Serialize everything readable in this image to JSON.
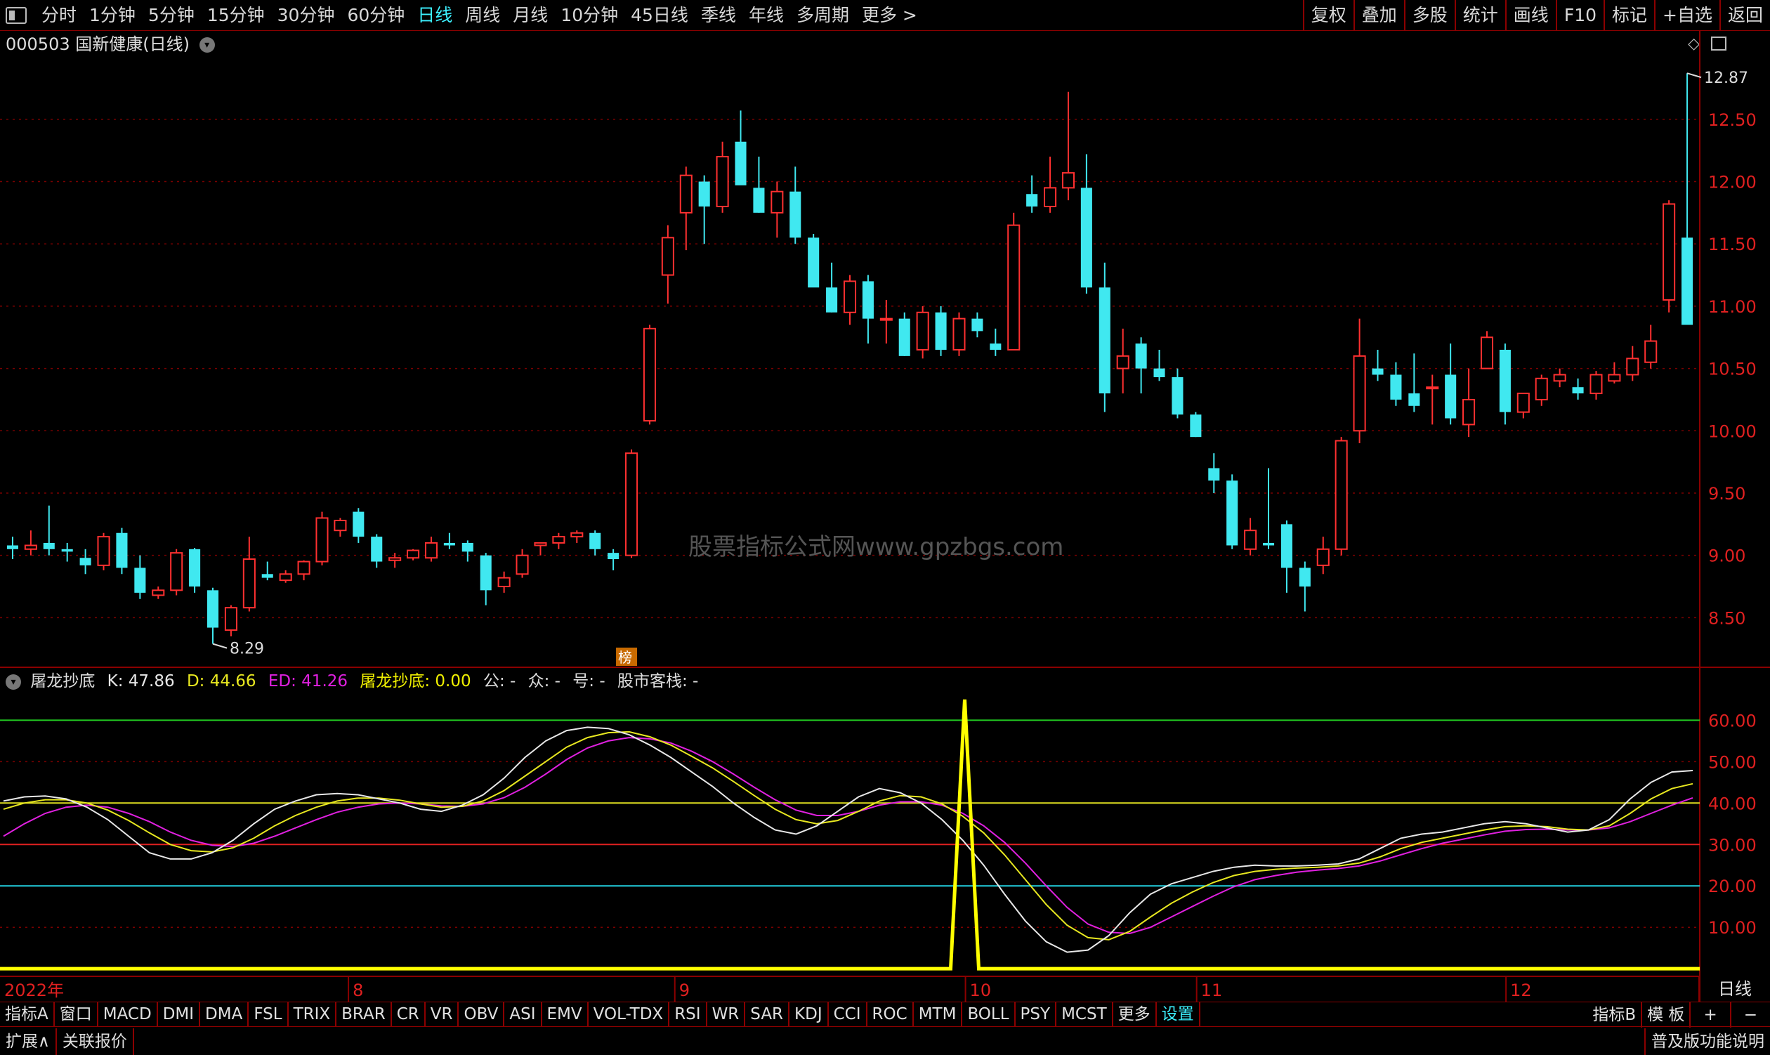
{
  "toolbar": {
    "periods": [
      "分时",
      "1分钟",
      "5分钟",
      "15分钟",
      "30分钟",
      "60分钟",
      "日线",
      "周线",
      "月线",
      "10分钟",
      "45日线",
      "季线",
      "年线",
      "多周期",
      "更多 >"
    ],
    "active_period": "日线",
    "right_buttons": [
      "复权",
      "叠加",
      "多股",
      "统计",
      "画线",
      "F10",
      "标记",
      "+自选",
      "返回"
    ]
  },
  "stock": {
    "code": "000503",
    "name": "国新健康",
    "period_label": "(日线)",
    "title": "000503 国新健康(日线)"
  },
  "price_axis": {
    "labels": [
      "12.50",
      "12.00",
      "11.50",
      "11.00",
      "10.50",
      "10.00",
      "9.50",
      "9.00",
      "8.50"
    ],
    "values": [
      12.5,
      12.0,
      11.5,
      11.0,
      10.5,
      10.0,
      9.5,
      9.0,
      8.5
    ],
    "ylim": [
      8.13,
      12.95
    ]
  },
  "annotations": {
    "high": "12.87",
    "low": "8.29",
    "rank_badge": "榜",
    "watermark": "股票指标公式网www.gpzbgs.com"
  },
  "indicator": {
    "name": "屠龙抄底",
    "k_label": "K: 47.86",
    "d_label": "D: 44.66",
    "ed_label": "ED: 41.26",
    "signal_label": "屠龙抄底: 0.00",
    "extra": [
      "公: -",
      "众: -",
      "号: -",
      "股市客栈: -"
    ],
    "axis_labels": [
      "60.00",
      "50.00",
      "40.00",
      "30.00",
      "20.00",
      "10.00"
    ],
    "axis_values": [
      60,
      50,
      40,
      30,
      20,
      10
    ],
    "ylim": [
      -1.5,
      66
    ],
    "level_lines": [
      {
        "v": 60,
        "color": "#22cc22"
      },
      {
        "v": 40,
        "color": "#e0e020"
      },
      {
        "v": 30,
        "color": "#e02020"
      },
      {
        "v": 20,
        "color": "#22d0e0"
      }
    ]
  },
  "date_axis": {
    "labels": [
      "2022年",
      "8",
      "9",
      "10",
      "11",
      "12"
    ],
    "positions": [
      0,
      20.5,
      39.7,
      56.8,
      70.4,
      88.6
    ]
  },
  "chart_data": {
    "type": "candlestick",
    "n": 93,
    "ylim": [
      8.13,
      12.95
    ],
    "ohlc": [
      [
        9.08,
        9.15,
        8.97,
        9.05
      ],
      [
        9.05,
        9.2,
        9.0,
        9.08
      ],
      [
        9.1,
        9.4,
        9.0,
        9.05
      ],
      [
        9.05,
        9.1,
        8.95,
        9.03
      ],
      [
        8.98,
        9.05,
        8.85,
        8.92
      ],
      [
        8.92,
        9.18,
        8.88,
        9.15
      ],
      [
        9.18,
        9.22,
        8.85,
        8.9
      ],
      [
        8.9,
        9.0,
        8.65,
        8.7
      ],
      [
        8.68,
        8.75,
        8.65,
        8.72
      ],
      [
        8.72,
        9.05,
        8.68,
        9.02
      ],
      [
        9.05,
        9.06,
        8.7,
        8.75
      ],
      [
        8.72,
        8.74,
        8.29,
        8.42
      ],
      [
        8.4,
        8.6,
        8.35,
        8.58
      ],
      [
        8.58,
        9.15,
        8.55,
        8.97
      ],
      [
        8.85,
        8.95,
        8.8,
        8.82
      ],
      [
        8.8,
        8.88,
        8.78,
        8.85
      ],
      [
        8.85,
        8.96,
        8.8,
        8.95
      ],
      [
        8.95,
        9.35,
        8.92,
        9.3
      ],
      [
        9.2,
        9.3,
        9.15,
        9.28
      ],
      [
        9.35,
        9.38,
        9.1,
        9.15
      ],
      [
        9.15,
        9.17,
        8.9,
        8.95
      ],
      [
        8.96,
        9.02,
        8.9,
        8.98
      ],
      [
        8.98,
        9.05,
        8.96,
        9.04
      ],
      [
        8.98,
        9.15,
        8.95,
        9.1
      ],
      [
        9.1,
        9.18,
        9.05,
        9.08
      ],
      [
        9.1,
        9.12,
        8.95,
        9.03
      ],
      [
        9.0,
        9.02,
        8.6,
        8.72
      ],
      [
        8.75,
        8.87,
        8.7,
        8.82
      ],
      [
        8.85,
        9.05,
        8.82,
        9.0
      ],
      [
        9.08,
        9.1,
        9.0,
        9.1
      ],
      [
        9.1,
        9.18,
        9.05,
        9.15
      ],
      [
        9.15,
        9.2,
        9.1,
        9.18
      ],
      [
        9.18,
        9.2,
        9.0,
        9.05
      ],
      [
        9.02,
        9.05,
        8.88,
        8.97
      ],
      [
        9.0,
        9.85,
        8.98,
        9.82
      ],
      [
        10.08,
        10.85,
        10.05,
        10.82
      ],
      [
        11.25,
        11.65,
        11.02,
        11.55
      ],
      [
        11.75,
        12.12,
        11.45,
        12.05
      ],
      [
        12.0,
        12.05,
        11.5,
        11.8
      ],
      [
        11.8,
        12.32,
        11.75,
        12.2
      ],
      [
        12.32,
        12.57,
        12.0,
        11.97
      ],
      [
        11.95,
        12.2,
        11.75,
        11.75
      ],
      [
        11.75,
        12.0,
        11.55,
        11.92
      ],
      [
        11.92,
        12.12,
        11.5,
        11.55
      ],
      [
        11.55,
        11.58,
        11.2,
        11.15
      ],
      [
        11.15,
        11.35,
        10.95,
        10.95
      ],
      [
        10.95,
        11.25,
        10.85,
        11.2
      ],
      [
        11.2,
        11.25,
        10.7,
        10.9
      ],
      [
        10.9,
        11.05,
        10.7,
        10.9
      ],
      [
        10.9,
        10.95,
        10.6,
        10.6
      ],
      [
        10.65,
        11.0,
        10.58,
        10.95
      ],
      [
        10.95,
        11.0,
        10.6,
        10.65
      ],
      [
        10.65,
        10.95,
        10.6,
        10.9
      ],
      [
        10.9,
        10.95,
        10.75,
        10.8
      ],
      [
        10.7,
        10.82,
        10.6,
        10.65
      ],
      [
        10.65,
        11.75,
        10.65,
        11.65
      ],
      [
        11.9,
        12.05,
        11.75,
        11.8
      ],
      [
        11.8,
        12.2,
        11.75,
        11.95
      ],
      [
        11.95,
        12.72,
        11.85,
        12.07
      ],
      [
        11.95,
        12.22,
        11.1,
        11.15
      ],
      [
        11.15,
        11.35,
        10.15,
        10.3
      ],
      [
        10.5,
        10.82,
        10.3,
        10.6
      ],
      [
        10.7,
        10.75,
        10.3,
        10.5
      ],
      [
        10.5,
        10.65,
        10.4,
        10.43
      ],
      [
        10.43,
        10.5,
        10.1,
        10.13
      ],
      [
        10.13,
        10.15,
        9.95,
        9.95
      ],
      [
        9.7,
        9.82,
        9.5,
        9.6
      ],
      [
        9.6,
        9.65,
        9.05,
        9.08
      ],
      [
        9.05,
        9.3,
        9.0,
        9.2
      ],
      [
        9.1,
        9.7,
        9.05,
        9.08
      ],
      [
        9.25,
        9.28,
        8.7,
        8.9
      ],
      [
        8.9,
        8.95,
        8.55,
        8.75
      ],
      [
        8.92,
        9.15,
        8.85,
        9.05
      ],
      [
        9.05,
        9.95,
        9.0,
        9.92
      ],
      [
        10.0,
        10.9,
        9.9,
        10.6
      ],
      [
        10.5,
        10.65,
        10.4,
        10.45
      ],
      [
        10.45,
        10.55,
        10.2,
        10.25
      ],
      [
        10.3,
        10.62,
        10.15,
        10.2
      ],
      [
        10.35,
        10.45,
        10.05,
        10.35
      ],
      [
        10.45,
        10.7,
        10.05,
        10.1
      ],
      [
        10.05,
        10.5,
        9.95,
        10.25
      ],
      [
        10.5,
        10.8,
        10.5,
        10.75
      ],
      [
        10.65,
        10.7,
        10.05,
        10.15
      ],
      [
        10.15,
        10.3,
        10.1,
        10.3
      ],
      [
        10.25,
        10.45,
        10.2,
        10.42
      ],
      [
        10.4,
        10.5,
        10.35,
        10.45
      ],
      [
        10.35,
        10.42,
        10.25,
        10.3
      ],
      [
        10.3,
        10.48,
        10.25,
        10.45
      ],
      [
        10.4,
        10.55,
        10.38,
        10.45
      ],
      [
        10.45,
        10.68,
        10.4,
        10.58
      ],
      [
        10.55,
        10.85,
        10.5,
        10.72
      ],
      [
        11.05,
        11.85,
        10.95,
        11.82
      ],
      [
        11.55,
        12.87,
        11.35,
        10.85
      ]
    ],
    "k": [
      40.5,
      41.5,
      41.7,
      41.0,
      39.0,
      36.0,
      32.0,
      28.0,
      26.5,
      26.5,
      28.0,
      31.0,
      35.0,
      38.5,
      40.5,
      42.0,
      42.3,
      42.0,
      41.0,
      40.0,
      38.5,
      38.0,
      39.5,
      42.0,
      46.0,
      51.0,
      55.0,
      57.5,
      58.3,
      58.0,
      56.5,
      54.0,
      51.0,
      47.5,
      44.0,
      40.0,
      36.5,
      33.5,
      32.5,
      34.5,
      38.0,
      41.5,
      43.5,
      42.5,
      40.0,
      36.0,
      31.0,
      25.0,
      18.0,
      11.5,
      6.5,
      4.0,
      4.5,
      8.0,
      13.5,
      18.0,
      20.5,
      22.0,
      23.5,
      24.5,
      25.0,
      24.8,
      24.8,
      25.0,
      25.3,
      26.5,
      29.0,
      31.5,
      32.5,
      33.0,
      34.0,
      35.0,
      35.5,
      35.0,
      34.0,
      33.0,
      33.5,
      36.0,
      41.0,
      45.0,
      47.5,
      47.86
    ],
    "d": [
      38.5,
      40.0,
      40.8,
      40.8,
      40.0,
      38.3,
      35.8,
      32.8,
      30.0,
      28.5,
      28.2,
      29.2,
      31.5,
      34.5,
      37.0,
      39.0,
      40.5,
      41.2,
      41.2,
      40.7,
      39.8,
      39.0,
      39.2,
      40.5,
      43.0,
      46.5,
      50.0,
      53.5,
      55.8,
      57.0,
      57.2,
      56.0,
      54.0,
      51.3,
      48.5,
      45.2,
      41.8,
      38.5,
      36.0,
      35.0,
      35.8,
      38.0,
      40.5,
      41.8,
      41.5,
      39.8,
      36.8,
      32.8,
      27.5,
      21.5,
      15.5,
      10.5,
      7.5,
      7.0,
      9.0,
      12.5,
      15.8,
      18.5,
      20.8,
      22.5,
      23.5,
      24.0,
      24.3,
      24.5,
      24.8,
      25.5,
      27.0,
      29.0,
      30.5,
      31.5,
      32.5,
      33.5,
      34.3,
      34.5,
      34.3,
      33.7,
      33.5,
      34.5,
      37.5,
      41.0,
      43.5,
      44.66
    ],
    "ed": [
      32.0,
      35.0,
      37.5,
      39.0,
      39.5,
      39.0,
      37.5,
      35.5,
      33.0,
      31.0,
      29.8,
      29.5,
      30.3,
      32.0,
      34.0,
      36.0,
      37.8,
      39.0,
      39.8,
      40.0,
      39.8,
      39.3,
      39.2,
      39.8,
      41.3,
      43.8,
      47.0,
      50.5,
      53.3,
      55.0,
      55.8,
      55.5,
      54.5,
      52.5,
      50.0,
      47.0,
      43.8,
      40.8,
      38.3,
      37.0,
      37.0,
      38.0,
      39.5,
      40.3,
      40.3,
      39.5,
      37.5,
      34.5,
      30.5,
      25.5,
      20.0,
      14.8,
      10.8,
      8.8,
      8.5,
      10.0,
      12.5,
      15.0,
      17.5,
      19.8,
      21.5,
      22.5,
      23.3,
      23.8,
      24.2,
      24.8,
      26.0,
      27.5,
      29.0,
      30.3,
      31.3,
      32.3,
      33.2,
      33.6,
      33.7,
      33.5,
      33.5,
      34.0,
      35.5,
      37.5,
      39.5,
      41.26
    ],
    "signal": {
      "spike_index": 52,
      "spike_value": 65,
      "baseline": 0
    }
  }
}
